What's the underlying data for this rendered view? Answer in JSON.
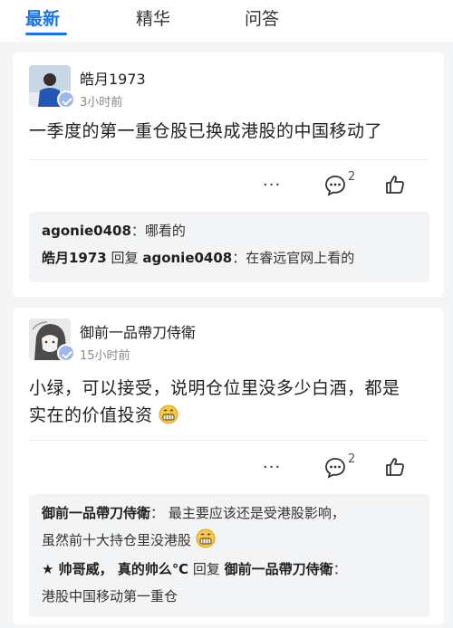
{
  "tabs": [
    {
      "label": "最新"
    },
    {
      "label": "精华"
    },
    {
      "label": "问答"
    }
  ],
  "posts": [
    {
      "username": "皓月1973",
      "time": "3小时前",
      "text": "一季度的第一重仓股已换成港股的中国移动了",
      "more": "···",
      "comment_count": "2",
      "replies": [
        {
          "name": "agonie0408",
          "sep": "：",
          "text": "哪看的"
        },
        {
          "name": "皓月1973",
          "reply_word": "回复",
          "target": "agonie0408",
          "sep": "：",
          "text": "在睿远官网上看的"
        }
      ]
    },
    {
      "username": "御前一品帶刀侍衛",
      "time": "15小时前",
      "text_line1": "小绿，可以接受，说明仓位里没多少白酒，都是",
      "text_line2": "实在的价值投资",
      "more": "···",
      "comment_count": "2",
      "replies": [
        {
          "name": "御前一品帶刀侍衛",
          "sep": "：",
          "text_line1": "最主要应该还是受港股影响，",
          "text_line2": "虽然前十大持仓里没港股"
        },
        {
          "name": "★ 帅哥威， 真的帅么℃",
          "reply_word": "回复",
          "target": "御前一品帶刀侍衛",
          "sep": "：",
          "text": "港股中国移动第一重仓"
        }
      ]
    }
  ],
  "icons": {
    "comment": "comment-bubble-icon",
    "like": "thumbs-up-icon",
    "verified": "verified-badge-icon",
    "emoji": "grinning-emoji-icon"
  },
  "colors": {
    "accent": "#1a73e8",
    "badge": "#9bb7ec"
  }
}
